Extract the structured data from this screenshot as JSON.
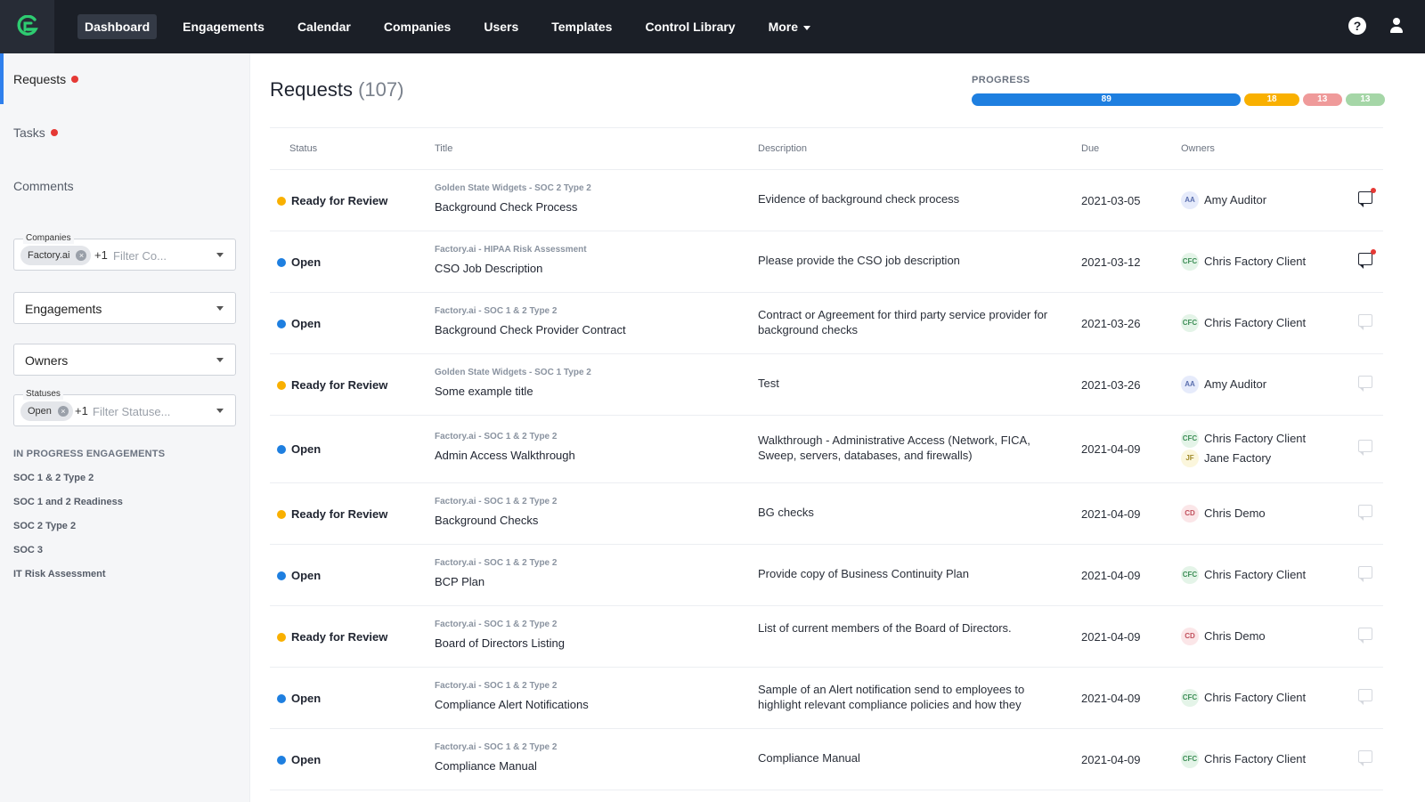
{
  "nav": {
    "items": [
      {
        "label": "Dashboard",
        "active": true
      },
      {
        "label": "Engagements"
      },
      {
        "label": "Calendar"
      },
      {
        "label": "Companies"
      },
      {
        "label": "Users"
      },
      {
        "label": "Templates"
      },
      {
        "label": "Control Library"
      },
      {
        "label": "More"
      }
    ],
    "help_glyph": "?"
  },
  "sidebar": {
    "links": [
      "Requests",
      "Tasks",
      "Comments"
    ],
    "companies_filter": {
      "label": "Companies",
      "chip": "Factory.ai",
      "more": "+1",
      "placeholder": "Filter Co..."
    },
    "engagements_filter": {
      "text": "Engagements"
    },
    "owners_filter": {
      "text": "Owners"
    },
    "statuses_filter": {
      "label": "Statuses",
      "chip": "Open",
      "more": "+1",
      "placeholder": "Filter Statuse..."
    },
    "section_title": "IN PROGRESS ENGAGEMENTS",
    "engagements": [
      "SOC 1 & 2 Type 2",
      "SOC 1 and 2 Readiness",
      "SOC 2 Type 2",
      "SOC 3",
      "IT Risk Assessment"
    ]
  },
  "main": {
    "title": "Requests",
    "count": "(107)",
    "progress": {
      "label": "PROGRESS",
      "segments": [
        {
          "value": "89",
          "color": "#1e7fe0"
        },
        {
          "value": "18",
          "color": "#f9b000"
        },
        {
          "value": "13",
          "color": "#ef9a9a"
        },
        {
          "value": "13",
          "color": "#a5d6a7"
        }
      ]
    },
    "columns": [
      "Status",
      "Title",
      "Description",
      "Due",
      "Owners"
    ]
  },
  "colors": {
    "ready": "#f9b000",
    "open": "#1e7fe0"
  },
  "rows": [
    {
      "status": "Ready for Review",
      "eng": "Golden State Widgets - SOC 2 Type 2",
      "title": "Background Check Process",
      "desc": "Evidence of background check process",
      "due": "2021-03-05",
      "owners": [
        {
          "initials": "AA",
          "name": "Amy Auditor"
        }
      ],
      "comment": "unread"
    },
    {
      "status": "Open",
      "eng": "Factory.ai - HIPAA Risk Assessment",
      "title": "CSO Job Description",
      "desc": "Please provide the CSO job description",
      "due": "2021-03-12",
      "owners": [
        {
          "initials": "CFC",
          "name": "Chris Factory Client"
        }
      ],
      "comment": "unread"
    },
    {
      "status": "Open",
      "eng": "Factory.ai - SOC 1 & 2 Type 2",
      "title": "Background Check Provider Contract",
      "desc": "Contract or Agreement for third party service provider for background checks",
      "due": "2021-03-26",
      "owners": [
        {
          "initials": "CFC",
          "name": "Chris Factory Client"
        }
      ],
      "comment": "none"
    },
    {
      "status": "Ready for Review",
      "eng": "Golden State Widgets - SOC 1 Type 2",
      "title": "Some example title",
      "desc": "Test",
      "due": "2021-03-26",
      "owners": [
        {
          "initials": "AA",
          "name": "Amy Auditor"
        }
      ],
      "comment": "none"
    },
    {
      "status": "Open",
      "eng": "Factory.ai - SOC 1 & 2 Type 2",
      "title": "Admin Access Walkthrough",
      "desc": "Walkthrough - Administrative Access (Network, FICA, Sweep, servers, databases, and firewalls)",
      "due": "2021-04-09",
      "owners": [
        {
          "initials": "CFC",
          "name": "Chris Factory Client"
        },
        {
          "initials": "JF",
          "name": "Jane Factory"
        }
      ],
      "comment": "none"
    },
    {
      "status": "Ready for Review",
      "eng": "Factory.ai - SOC 1 & 2 Type 2",
      "title": "Background Checks",
      "desc": "BG checks",
      "due": "2021-04-09",
      "owners": [
        {
          "initials": "CD",
          "name": "Chris Demo"
        }
      ],
      "comment": "none"
    },
    {
      "status": "Open",
      "eng": "Factory.ai - SOC 1 & 2 Type 2",
      "title": "BCP Plan",
      "desc": "Provide copy of Business Continuity Plan",
      "due": "2021-04-09",
      "owners": [
        {
          "initials": "CFC",
          "name": "Chris Factory Client"
        }
      ],
      "comment": "none"
    },
    {
      "status": "Ready for Review",
      "eng": "Factory.ai - SOC 1 & 2 Type 2",
      "title": "Board of Directors Listing",
      "desc": "List of current members of the Board of Directors.",
      "due": "2021-04-09",
      "owners": [
        {
          "initials": "CD",
          "name": "Chris Demo"
        }
      ],
      "comment": "none"
    },
    {
      "status": "Open",
      "eng": "Factory.ai - SOC 1 & 2 Type 2",
      "title": "Compliance Alert Notifications",
      "desc": "Sample of an Alert notification send to employees to highlight relevant compliance policies and how they",
      "due": "2021-04-09",
      "owners": [
        {
          "initials": "CFC",
          "name": "Chris Factory Client"
        }
      ],
      "comment": "none"
    },
    {
      "status": "Open",
      "eng": "Factory.ai - SOC 1 & 2 Type 2",
      "title": "Compliance Manual",
      "desc": "Compliance Manual",
      "due": "2021-04-09",
      "owners": [
        {
          "initials": "CFC",
          "name": "Chris Factory Client"
        }
      ],
      "comment": "none"
    }
  ]
}
